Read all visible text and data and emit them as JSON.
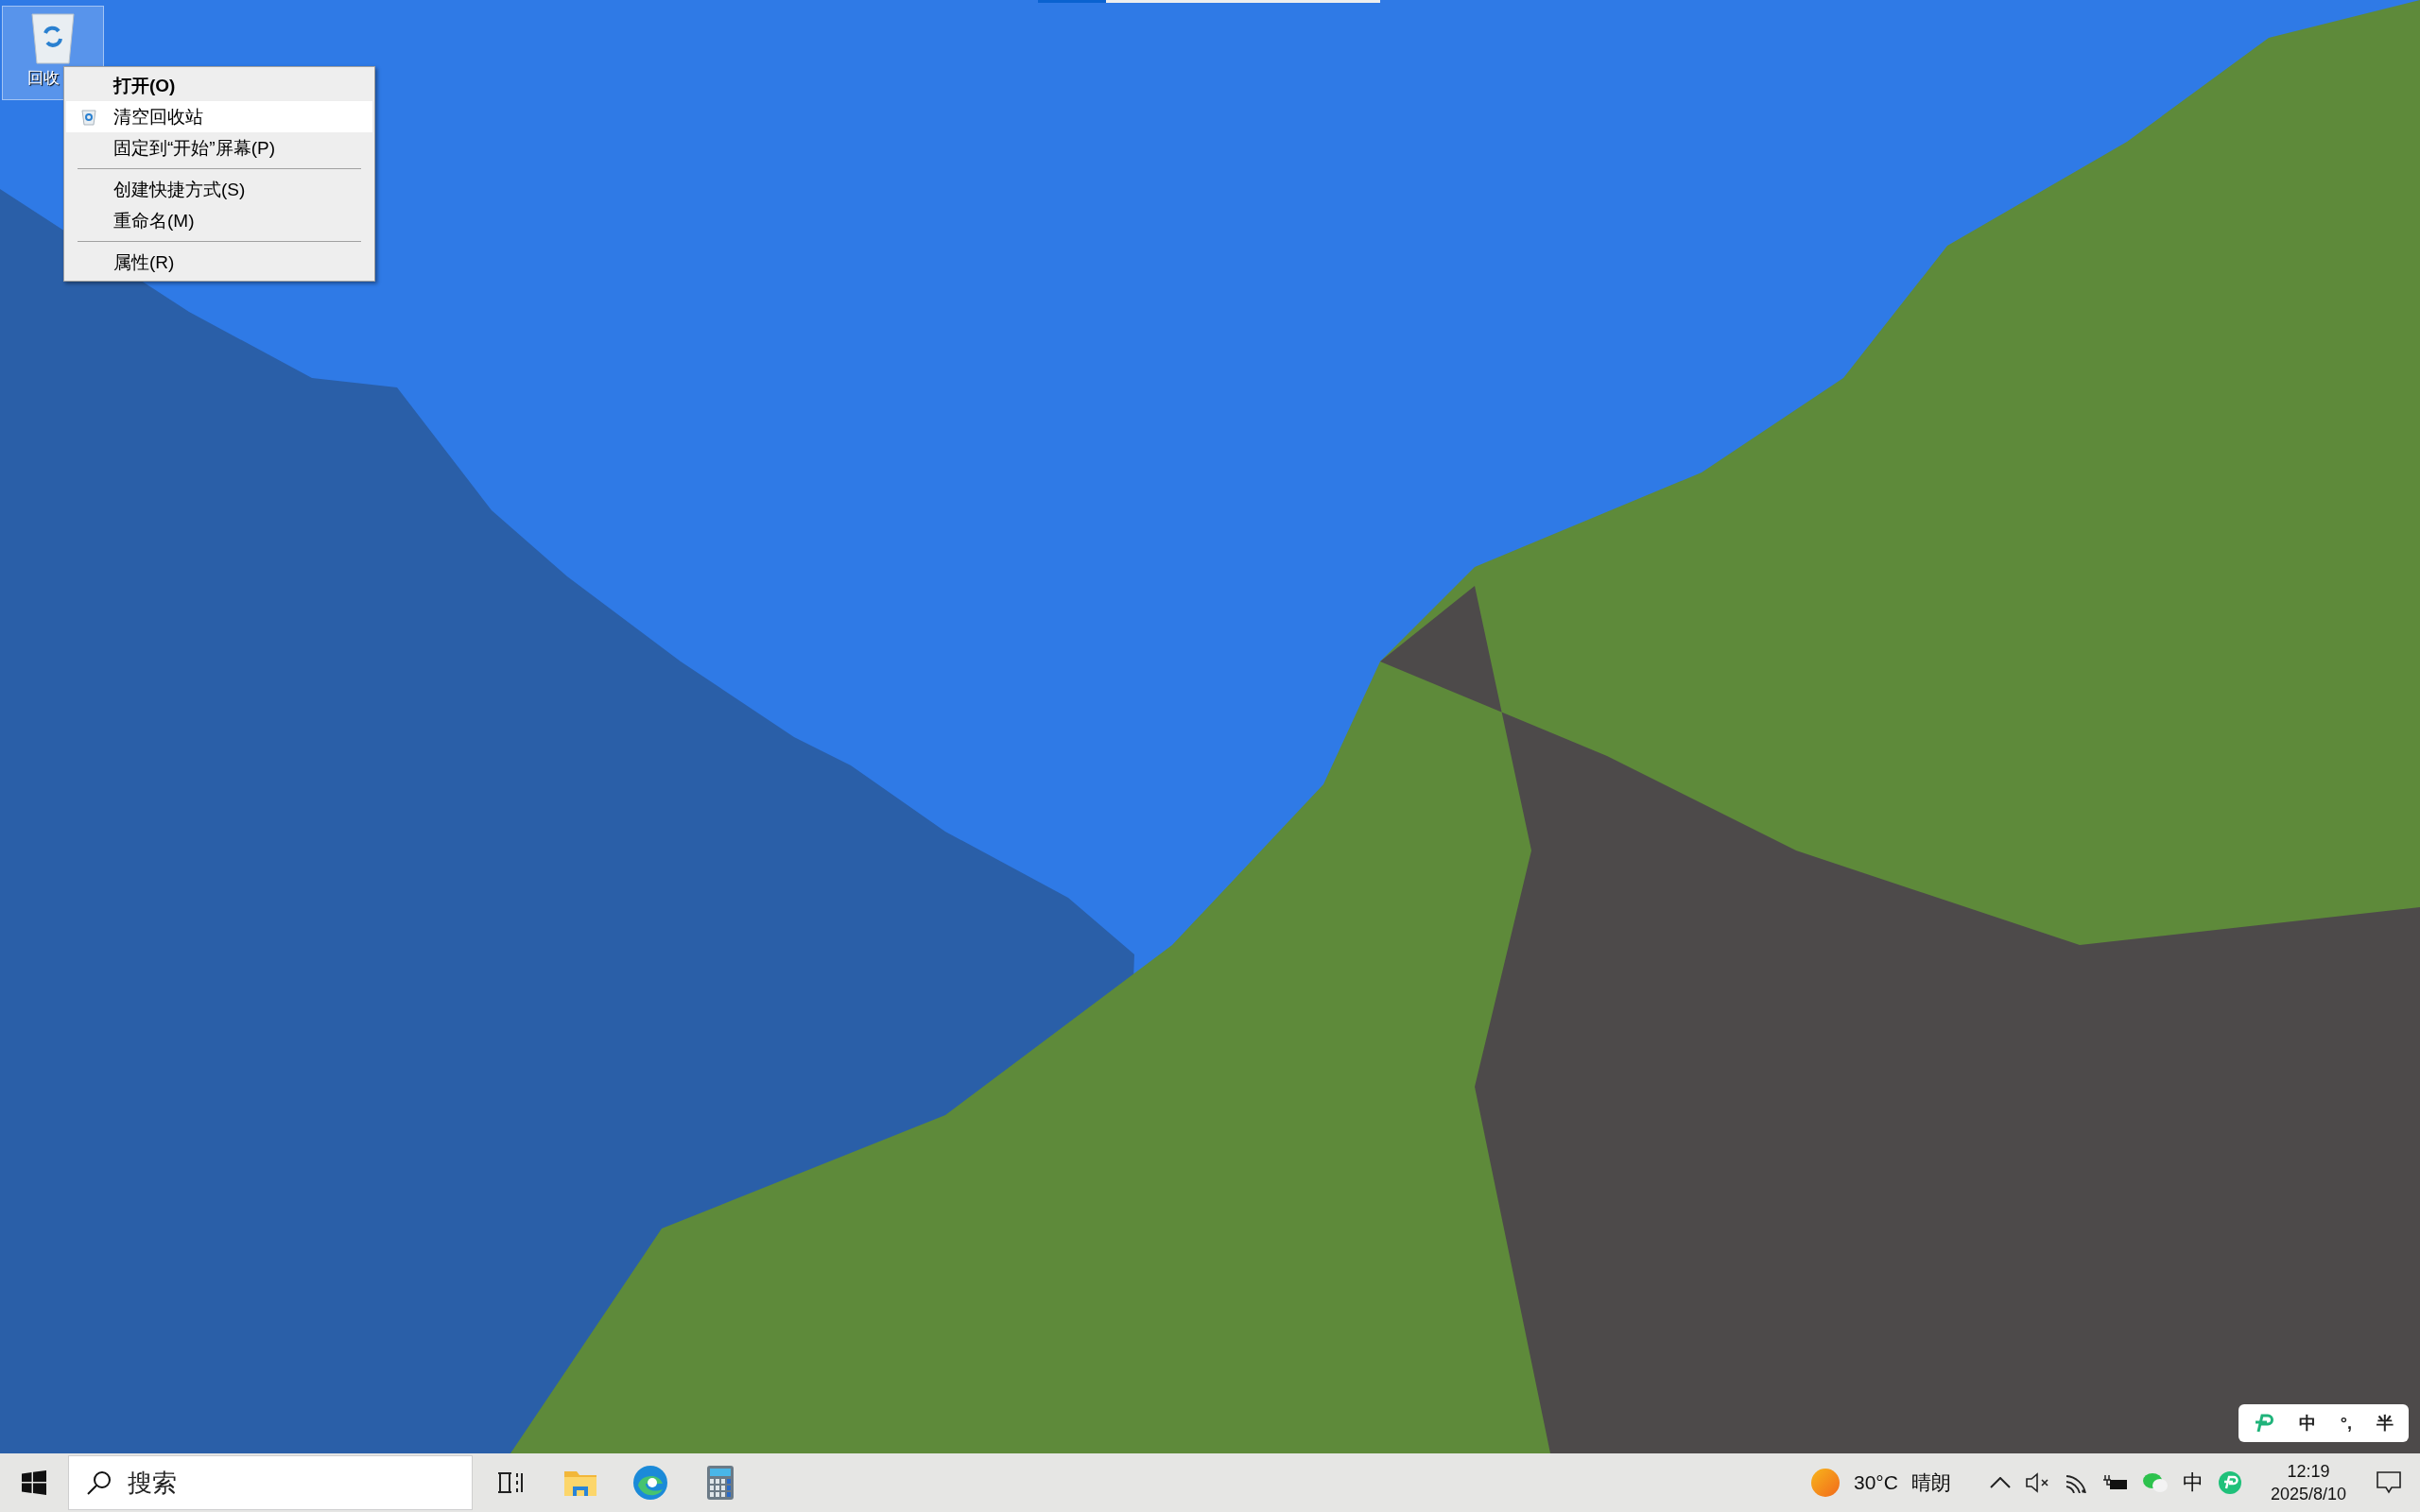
{
  "top_progress": {
    "level": 0.2
  },
  "desktop_icons": [
    {
      "label": "回收",
      "selected": true
    }
  ],
  "context_menu": {
    "items": [
      {
        "kind": "item",
        "label": "打开(O)",
        "default": true,
        "selected": false,
        "icon": false
      },
      {
        "kind": "item",
        "label": "清空回收站",
        "default": false,
        "selected": true,
        "icon": true
      },
      {
        "kind": "item",
        "label": "固定到“开始”屏幕(P)",
        "default": false,
        "selected": false,
        "icon": false
      },
      {
        "kind": "separator"
      },
      {
        "kind": "item",
        "label": "创建快捷方式(S)",
        "default": false,
        "selected": false,
        "icon": false
      },
      {
        "kind": "item",
        "label": "重命名(M)",
        "default": false,
        "selected": false,
        "icon": false
      },
      {
        "kind": "separator"
      },
      {
        "kind": "item",
        "label": "属性(R)",
        "default": false,
        "selected": false,
        "icon": false
      }
    ]
  },
  "ime_toolbar": {
    "items": [
      {
        "kind": "logo"
      },
      {
        "kind": "text",
        "label": "中"
      },
      {
        "kind": "text",
        "label": "°,"
      },
      {
        "kind": "text",
        "label": "半"
      }
    ]
  },
  "taskbar": {
    "search": {
      "placeholder": "搜索"
    },
    "apps": [
      {
        "kind": "taskview"
      },
      {
        "kind": "explorer"
      },
      {
        "kind": "edge"
      },
      {
        "kind": "calculator"
      }
    ],
    "weather": {
      "temperature": "30°C",
      "condition": "晴朗"
    },
    "tray": [
      {
        "kind": "chevron"
      },
      {
        "kind": "volume"
      },
      {
        "kind": "wifi"
      },
      {
        "kind": "battery"
      },
      {
        "kind": "chat"
      },
      {
        "kind": "ime",
        "label": "中"
      },
      {
        "kind": "imelogo"
      }
    ],
    "clock": {
      "time": "12:19",
      "date": "2025/8/10"
    }
  }
}
